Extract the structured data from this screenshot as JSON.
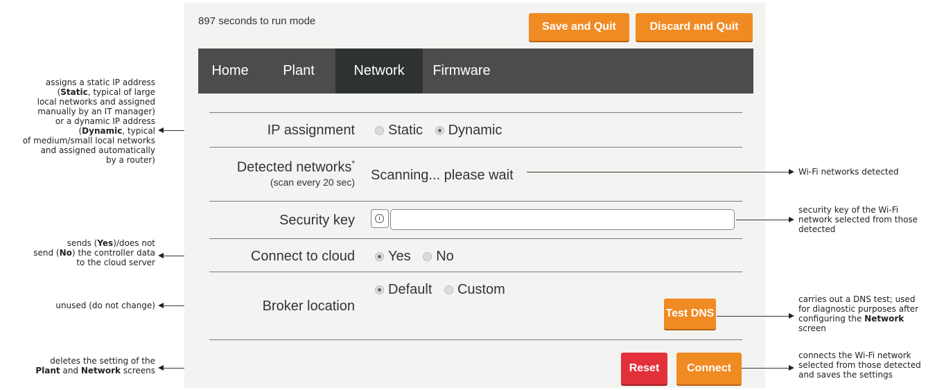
{
  "header": {
    "countdown": "897 seconds to run mode",
    "save_label": "Save and Quit",
    "discard_label": "Discard and Quit"
  },
  "nav": {
    "tabs": [
      {
        "label": "Home",
        "active": false
      },
      {
        "label": "Plant",
        "active": false
      },
      {
        "label": "Network",
        "active": true
      },
      {
        "label": "Firmware",
        "active": false
      }
    ]
  },
  "form": {
    "ip_assignment": {
      "label": "IP assignment",
      "options": [
        "Static",
        "Dynamic"
      ],
      "selected": "Dynamic"
    },
    "detected_networks": {
      "label": "Detected networks",
      "asterisk": "*",
      "sublabel": "(scan every 20 sec)",
      "status": "Scanning... please wait"
    },
    "security_key": {
      "label": "Security key",
      "icon": "info-icon",
      "value": ""
    },
    "connect_to_cloud": {
      "label": "Connect to cloud",
      "options": [
        "Yes",
        "No"
      ],
      "selected": "Yes"
    },
    "broker_location": {
      "label": "Broker location",
      "options": [
        "Default",
        "Custom"
      ],
      "selected": "Default"
    },
    "test_dns_label": "Test DNS",
    "reset_label": "Reset",
    "connect_label": "Connect"
  },
  "colors": {
    "orange_button": "#f08a22",
    "red_button": "#e2313a",
    "nav_bg": "#4c4c4c",
    "nav_active": "#2f3233",
    "panel_bg": "#f3f3f1"
  },
  "annotations": {
    "ip": "assigns a static IP address (<b>Static</b>, typical of large local networks and assigned manually by an IT manager) or a dynamic IP address (<b>Dynamic</b>, typical of medium/small local networks and assigned automatically by a router)",
    "cloud": "sends (<b>Yes</b>)/does not send (<b>No</b>) the controller data to the cloud server",
    "broker": "unused (do not change)",
    "reset": "deletes the setting of the <b>Plant</b> and <b>Network</b> screens",
    "networks": "Wi-Fi networks detected",
    "key": "security key of the Wi-Fi network selected from those detected",
    "dns": "carries out a DNS test; used for diagnostic purposes after configuring the <b>Network</b> screen",
    "connect": "connects the Wi-Fi network selected from those detected and saves the settings"
  }
}
